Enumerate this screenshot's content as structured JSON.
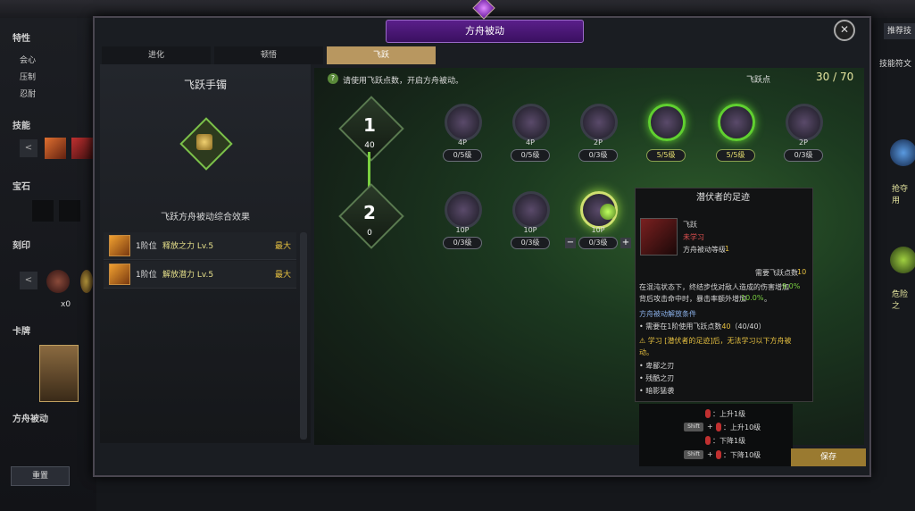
{
  "background": {
    "sections": {
      "traits": "特性",
      "skills": "技能",
      "gems": "宝石",
      "engravings": "刻印",
      "cards": "卡牌",
      "ark_passive": "方舟被动"
    },
    "traits": [
      "会心",
      "压制",
      "忍耐"
    ],
    "engraving_count": "x0",
    "reset_label": "重置",
    "recommend_label": "推荐技",
    "rune_label": "技能符文",
    "right_skill_1": "抢夺用",
    "right_skill_2": "危险之"
  },
  "window": {
    "title": "方舟被动",
    "close_label": "✕",
    "tabs": [
      "进化",
      "顿悟",
      "飞跃"
    ],
    "active_tab": 2
  },
  "left_panel": {
    "title": "飞跃手镯",
    "effect_title": "飞跃方舟被动综合效果",
    "effects": [
      {
        "tier": "1阶位",
        "name": "释放之力 Lv.5",
        "status": "最大"
      },
      {
        "tier": "1阶位",
        "name": "解放潜力 Lv.5",
        "status": "最大"
      }
    ]
  },
  "main": {
    "hint": "请使用飞跃点数，开启方舟被动。",
    "points_label": "飞跃点",
    "points_value": "30 / 70",
    "tiers": [
      {
        "number": "1",
        "points": "40"
      },
      {
        "number": "2",
        "points": "0"
      }
    ],
    "row1": [
      {
        "cost": "4P",
        "level": "0/5级"
      },
      {
        "cost": "4P",
        "level": "0/5级"
      },
      {
        "cost": "2P",
        "level": "0/3级"
      },
      {
        "cost": "",
        "level": "5/5级"
      },
      {
        "cost": "",
        "level": "5/5级"
      },
      {
        "cost": "2P",
        "level": "0/3级"
      }
    ],
    "row2": [
      {
        "cost": "10P",
        "level": "0/3级"
      },
      {
        "cost": "10P",
        "level": "0/3级"
      },
      {
        "cost": "10P",
        "level": "0/3级"
      }
    ],
    "minus_label": "−",
    "plus_label": "+"
  },
  "tooltip": {
    "title": "潜伏者的足迹",
    "type": "飞跃",
    "status": "未学习",
    "level_label": "方舟被动等级",
    "level_value": "1",
    "required_label": "需要飞跃点数",
    "required_value": "10",
    "desc_line1_a": "在混沌状态下，终结步伐对敌人造成的伤害增加",
    "desc_line1_b": "9.0%",
    "desc_line2_a": "背后攻击命中时，暴击率额外增加",
    "desc_line2_b": "10.0%",
    "desc_line2_c": "。",
    "unlock_title": "方舟被动解放条件",
    "cond1_a": "需要在1阶使用飞跃点数",
    "cond1_b": "40",
    "cond1_c": "（40/40）",
    "warning": "学习 [潜伏者的足迹]后，无法学习以下方舟被",
    "warning_cont": "动。",
    "blocked": [
      "卑鄙之刃",
      "残酷之刃",
      "暗影猛袭"
    ]
  },
  "keys": {
    "shift": "Shift",
    "up1": "：上升1级",
    "up10": "：上升10级",
    "down1": "：下降1级",
    "down10": "：下降10级"
  },
  "footer": {
    "save_label": "保存"
  }
}
